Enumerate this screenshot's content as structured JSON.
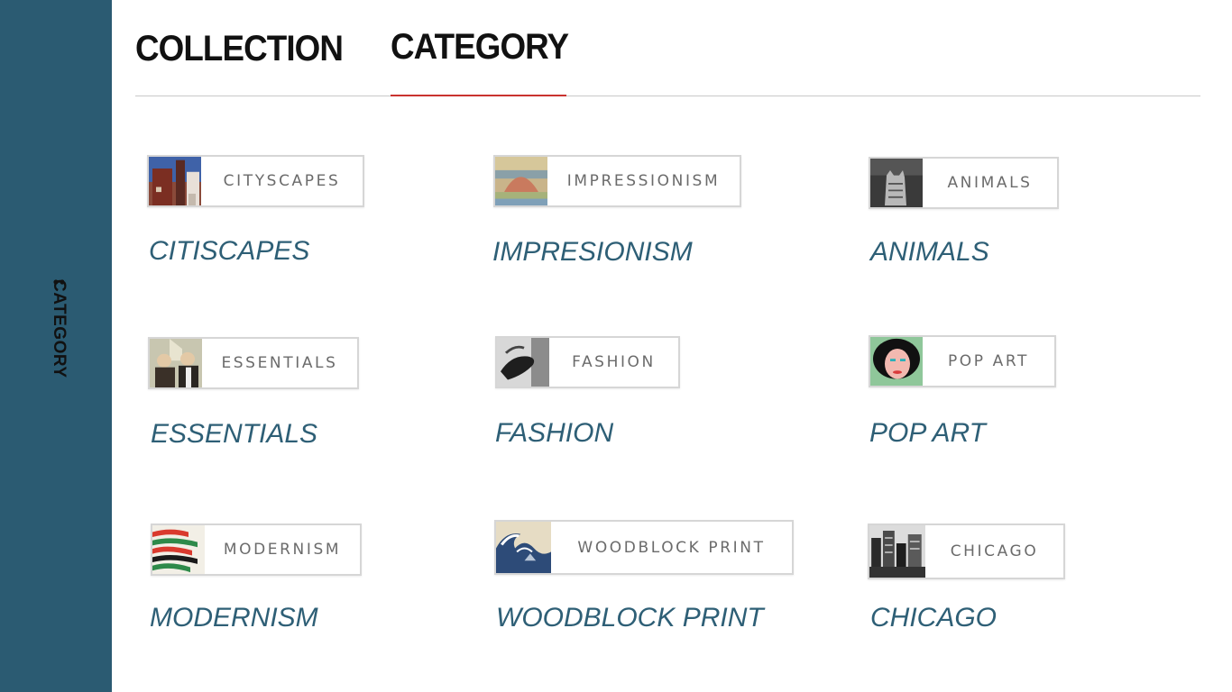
{
  "sidebar": {
    "label": "CATEGORY"
  },
  "tabs": [
    {
      "label": "COLLECTION"
    },
    {
      "label": "CATEGORY",
      "active": true
    }
  ],
  "colors": {
    "sidebar": "#2b5b72",
    "caption": "#2e5f76",
    "active_underline": "#c9332f",
    "divider": "#c9c9c9"
  },
  "categories": [
    {
      "card_label": "CITYSCAPES",
      "caption": "CITISCAPES",
      "icon": "cityscape-thumbnail-icon"
    },
    {
      "card_label": "IMPRESSIONISM",
      "caption": "IMPRESIONISM",
      "icon": "haystack-painting-icon"
    },
    {
      "card_label": "ANIMALS",
      "caption": "ANIMALS",
      "icon": "cat-photo-icon"
    },
    {
      "card_label": "ESSENTIALS",
      "caption": "ESSENTIALS",
      "icon": "american-gothic-icon"
    },
    {
      "card_label": "FASHION",
      "caption": "FASHION",
      "icon": "glove-photo-icon"
    },
    {
      "card_label": "POP ART",
      "caption": "POP ART",
      "icon": "pop-portrait-icon"
    },
    {
      "card_label": "MODERNISM",
      "caption": "MODERNISM",
      "icon": "abstract-stripes-icon"
    },
    {
      "card_label": "WOODBLOCK PRINT",
      "caption": "WOODBLOCK PRINT",
      "icon": "great-wave-icon"
    },
    {
      "card_label": "CHICAGO",
      "caption": "CHICAGO",
      "icon": "skyline-photo-icon"
    }
  ]
}
